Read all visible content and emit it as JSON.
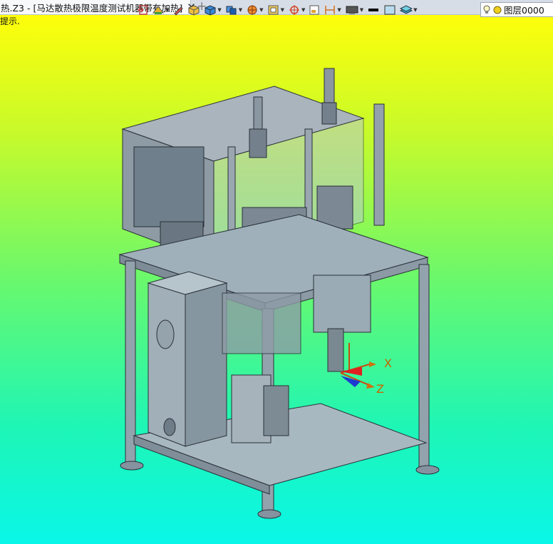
{
  "tab": {
    "title": "热.Z3 - [马达散热极限温度测试机器带有加热]",
    "close_glyph": "✕",
    "new_tab_glyph": "+"
  },
  "viewport": {
    "prompt_text": "提示.",
    "background_colors": [
      "#fefe0a",
      "#6af86c",
      "#09f6e8"
    ]
  },
  "toolbar": {
    "items": [
      "exit-icon",
      "view-shading-icon",
      "pencil-icon",
      "box-shaded-icon",
      "box-blue-icon",
      "view-cube-icon",
      "render-icon",
      "frame-icon",
      "crosshair-icon",
      "small-box-icon",
      "dimension-icon",
      "display-mode-icon",
      "color-black-swatch",
      "color-fill-swatch",
      "layer-stack-icon"
    ],
    "colors": {
      "line": "#000000",
      "fill": "#b8dcee",
      "accent": "#e09020"
    }
  },
  "layer": {
    "name": "图层0000",
    "bulb_icon": "lightbulb-icon",
    "status_icon": "yellow-dot-icon"
  },
  "model": {
    "axes": {
      "x_label": "X",
      "z_label": "Z"
    }
  }
}
